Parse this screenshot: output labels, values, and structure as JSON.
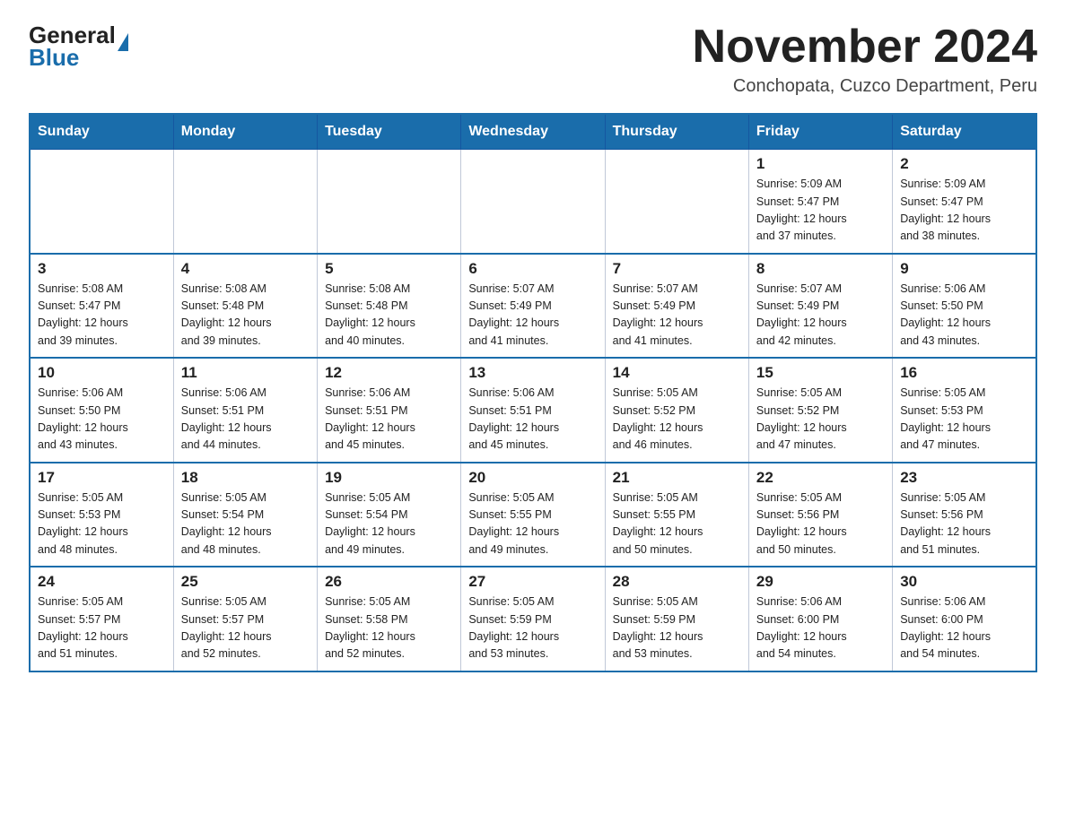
{
  "header": {
    "logo_general": "General",
    "logo_blue": "Blue",
    "title": "November 2024",
    "subtitle": "Conchopata, Cuzco Department, Peru"
  },
  "days_of_week": [
    "Sunday",
    "Monday",
    "Tuesday",
    "Wednesday",
    "Thursday",
    "Friday",
    "Saturday"
  ],
  "weeks": [
    [
      {
        "day": "",
        "info": ""
      },
      {
        "day": "",
        "info": ""
      },
      {
        "day": "",
        "info": ""
      },
      {
        "day": "",
        "info": ""
      },
      {
        "day": "",
        "info": ""
      },
      {
        "day": "1",
        "info": "Sunrise: 5:09 AM\nSunset: 5:47 PM\nDaylight: 12 hours\nand 37 minutes."
      },
      {
        "day": "2",
        "info": "Sunrise: 5:09 AM\nSunset: 5:47 PM\nDaylight: 12 hours\nand 38 minutes."
      }
    ],
    [
      {
        "day": "3",
        "info": "Sunrise: 5:08 AM\nSunset: 5:47 PM\nDaylight: 12 hours\nand 39 minutes."
      },
      {
        "day": "4",
        "info": "Sunrise: 5:08 AM\nSunset: 5:48 PM\nDaylight: 12 hours\nand 39 minutes."
      },
      {
        "day": "5",
        "info": "Sunrise: 5:08 AM\nSunset: 5:48 PM\nDaylight: 12 hours\nand 40 minutes."
      },
      {
        "day": "6",
        "info": "Sunrise: 5:07 AM\nSunset: 5:49 PM\nDaylight: 12 hours\nand 41 minutes."
      },
      {
        "day": "7",
        "info": "Sunrise: 5:07 AM\nSunset: 5:49 PM\nDaylight: 12 hours\nand 41 minutes."
      },
      {
        "day": "8",
        "info": "Sunrise: 5:07 AM\nSunset: 5:49 PM\nDaylight: 12 hours\nand 42 minutes."
      },
      {
        "day": "9",
        "info": "Sunrise: 5:06 AM\nSunset: 5:50 PM\nDaylight: 12 hours\nand 43 minutes."
      }
    ],
    [
      {
        "day": "10",
        "info": "Sunrise: 5:06 AM\nSunset: 5:50 PM\nDaylight: 12 hours\nand 43 minutes."
      },
      {
        "day": "11",
        "info": "Sunrise: 5:06 AM\nSunset: 5:51 PM\nDaylight: 12 hours\nand 44 minutes."
      },
      {
        "day": "12",
        "info": "Sunrise: 5:06 AM\nSunset: 5:51 PM\nDaylight: 12 hours\nand 45 minutes."
      },
      {
        "day": "13",
        "info": "Sunrise: 5:06 AM\nSunset: 5:51 PM\nDaylight: 12 hours\nand 45 minutes."
      },
      {
        "day": "14",
        "info": "Sunrise: 5:05 AM\nSunset: 5:52 PM\nDaylight: 12 hours\nand 46 minutes."
      },
      {
        "day": "15",
        "info": "Sunrise: 5:05 AM\nSunset: 5:52 PM\nDaylight: 12 hours\nand 47 minutes."
      },
      {
        "day": "16",
        "info": "Sunrise: 5:05 AM\nSunset: 5:53 PM\nDaylight: 12 hours\nand 47 minutes."
      }
    ],
    [
      {
        "day": "17",
        "info": "Sunrise: 5:05 AM\nSunset: 5:53 PM\nDaylight: 12 hours\nand 48 minutes."
      },
      {
        "day": "18",
        "info": "Sunrise: 5:05 AM\nSunset: 5:54 PM\nDaylight: 12 hours\nand 48 minutes."
      },
      {
        "day": "19",
        "info": "Sunrise: 5:05 AM\nSunset: 5:54 PM\nDaylight: 12 hours\nand 49 minutes."
      },
      {
        "day": "20",
        "info": "Sunrise: 5:05 AM\nSunset: 5:55 PM\nDaylight: 12 hours\nand 49 minutes."
      },
      {
        "day": "21",
        "info": "Sunrise: 5:05 AM\nSunset: 5:55 PM\nDaylight: 12 hours\nand 50 minutes."
      },
      {
        "day": "22",
        "info": "Sunrise: 5:05 AM\nSunset: 5:56 PM\nDaylight: 12 hours\nand 50 minutes."
      },
      {
        "day": "23",
        "info": "Sunrise: 5:05 AM\nSunset: 5:56 PM\nDaylight: 12 hours\nand 51 minutes."
      }
    ],
    [
      {
        "day": "24",
        "info": "Sunrise: 5:05 AM\nSunset: 5:57 PM\nDaylight: 12 hours\nand 51 minutes."
      },
      {
        "day": "25",
        "info": "Sunrise: 5:05 AM\nSunset: 5:57 PM\nDaylight: 12 hours\nand 52 minutes."
      },
      {
        "day": "26",
        "info": "Sunrise: 5:05 AM\nSunset: 5:58 PM\nDaylight: 12 hours\nand 52 minutes."
      },
      {
        "day": "27",
        "info": "Sunrise: 5:05 AM\nSunset: 5:59 PM\nDaylight: 12 hours\nand 53 minutes."
      },
      {
        "day": "28",
        "info": "Sunrise: 5:05 AM\nSunset: 5:59 PM\nDaylight: 12 hours\nand 53 minutes."
      },
      {
        "day": "29",
        "info": "Sunrise: 5:06 AM\nSunset: 6:00 PM\nDaylight: 12 hours\nand 54 minutes."
      },
      {
        "day": "30",
        "info": "Sunrise: 5:06 AM\nSunset: 6:00 PM\nDaylight: 12 hours\nand 54 minutes."
      }
    ]
  ]
}
